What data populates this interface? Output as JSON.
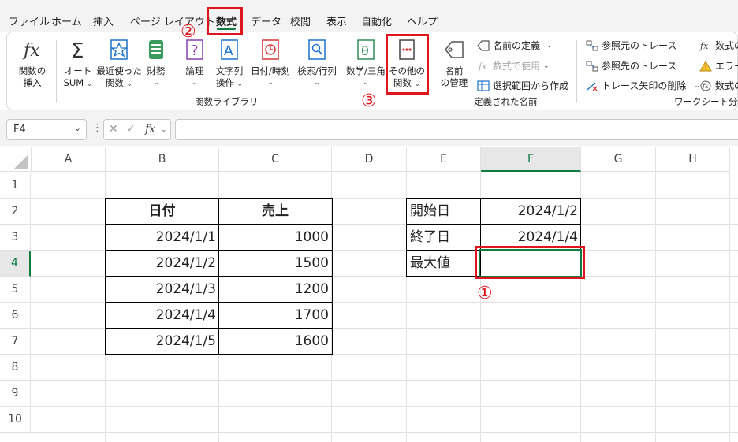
{
  "menu": {
    "tabs": [
      "ファイル",
      "ホーム",
      "挿入",
      "ページ レイアウト",
      "数式",
      "データ",
      "校閲",
      "表示",
      "自動化",
      "ヘルプ"
    ],
    "active_tab": "数式"
  },
  "ribbon": {
    "function_library": {
      "label": "関数ライブラリ",
      "insert_function": [
        "関数の",
        "挿入"
      ],
      "autosum": [
        "オート",
        "SUM"
      ],
      "recent": [
        "最近使った",
        "関数"
      ],
      "financial": "財務",
      "logical": "論理",
      "text": [
        "文字列",
        "操作"
      ],
      "datetime": "日付/時刻",
      "lookup": "検索/行列",
      "math": "数学/三角",
      "more": [
        "その他の",
        "関数"
      ]
    },
    "defined_names": {
      "label": "定義された名前",
      "name_manager": [
        "名前",
        "の管理"
      ],
      "define_name": "名前の定義",
      "use_in_formula": "数式で使用",
      "create_from_selection": "選択範囲から作成"
    },
    "formula_auditing": {
      "label": "ワークシート分析",
      "trace_precedents": "参照元のトレース",
      "trace_dependents": "参照先のトレース",
      "remove_arrows": "トレース矢印の削除",
      "show_formulas": "数式の",
      "error_checking": "エラー",
      "evaluate_formula": "数式の"
    }
  },
  "formula_bar": {
    "name_box": "F4",
    "fx": "fx",
    "value": ""
  },
  "sheet": {
    "columns": [
      "A",
      "B",
      "C",
      "D",
      "E",
      "F",
      "G",
      "H"
    ],
    "rows": [
      "1",
      "2",
      "3",
      "4",
      "5",
      "6",
      "7",
      "8",
      "9",
      "10"
    ],
    "selected_column": "F",
    "selected_row": "4",
    "table": {
      "headers": [
        "日付",
        "売上"
      ],
      "rows": [
        [
          "2024/1/1",
          "1000"
        ],
        [
          "2024/1/2",
          "1500"
        ],
        [
          "2024/1/3",
          "1200"
        ],
        [
          "2024/1/4",
          "1700"
        ],
        [
          "2024/1/5",
          "1600"
        ]
      ]
    },
    "params": {
      "rows": [
        [
          "開始日",
          "2024/1/2"
        ],
        [
          "終了日",
          "2024/1/4"
        ],
        [
          "最大値",
          ""
        ]
      ]
    }
  },
  "annotations": {
    "step1": "①",
    "step2": "②",
    "step3": "③",
    "color": "#e0141e"
  }
}
